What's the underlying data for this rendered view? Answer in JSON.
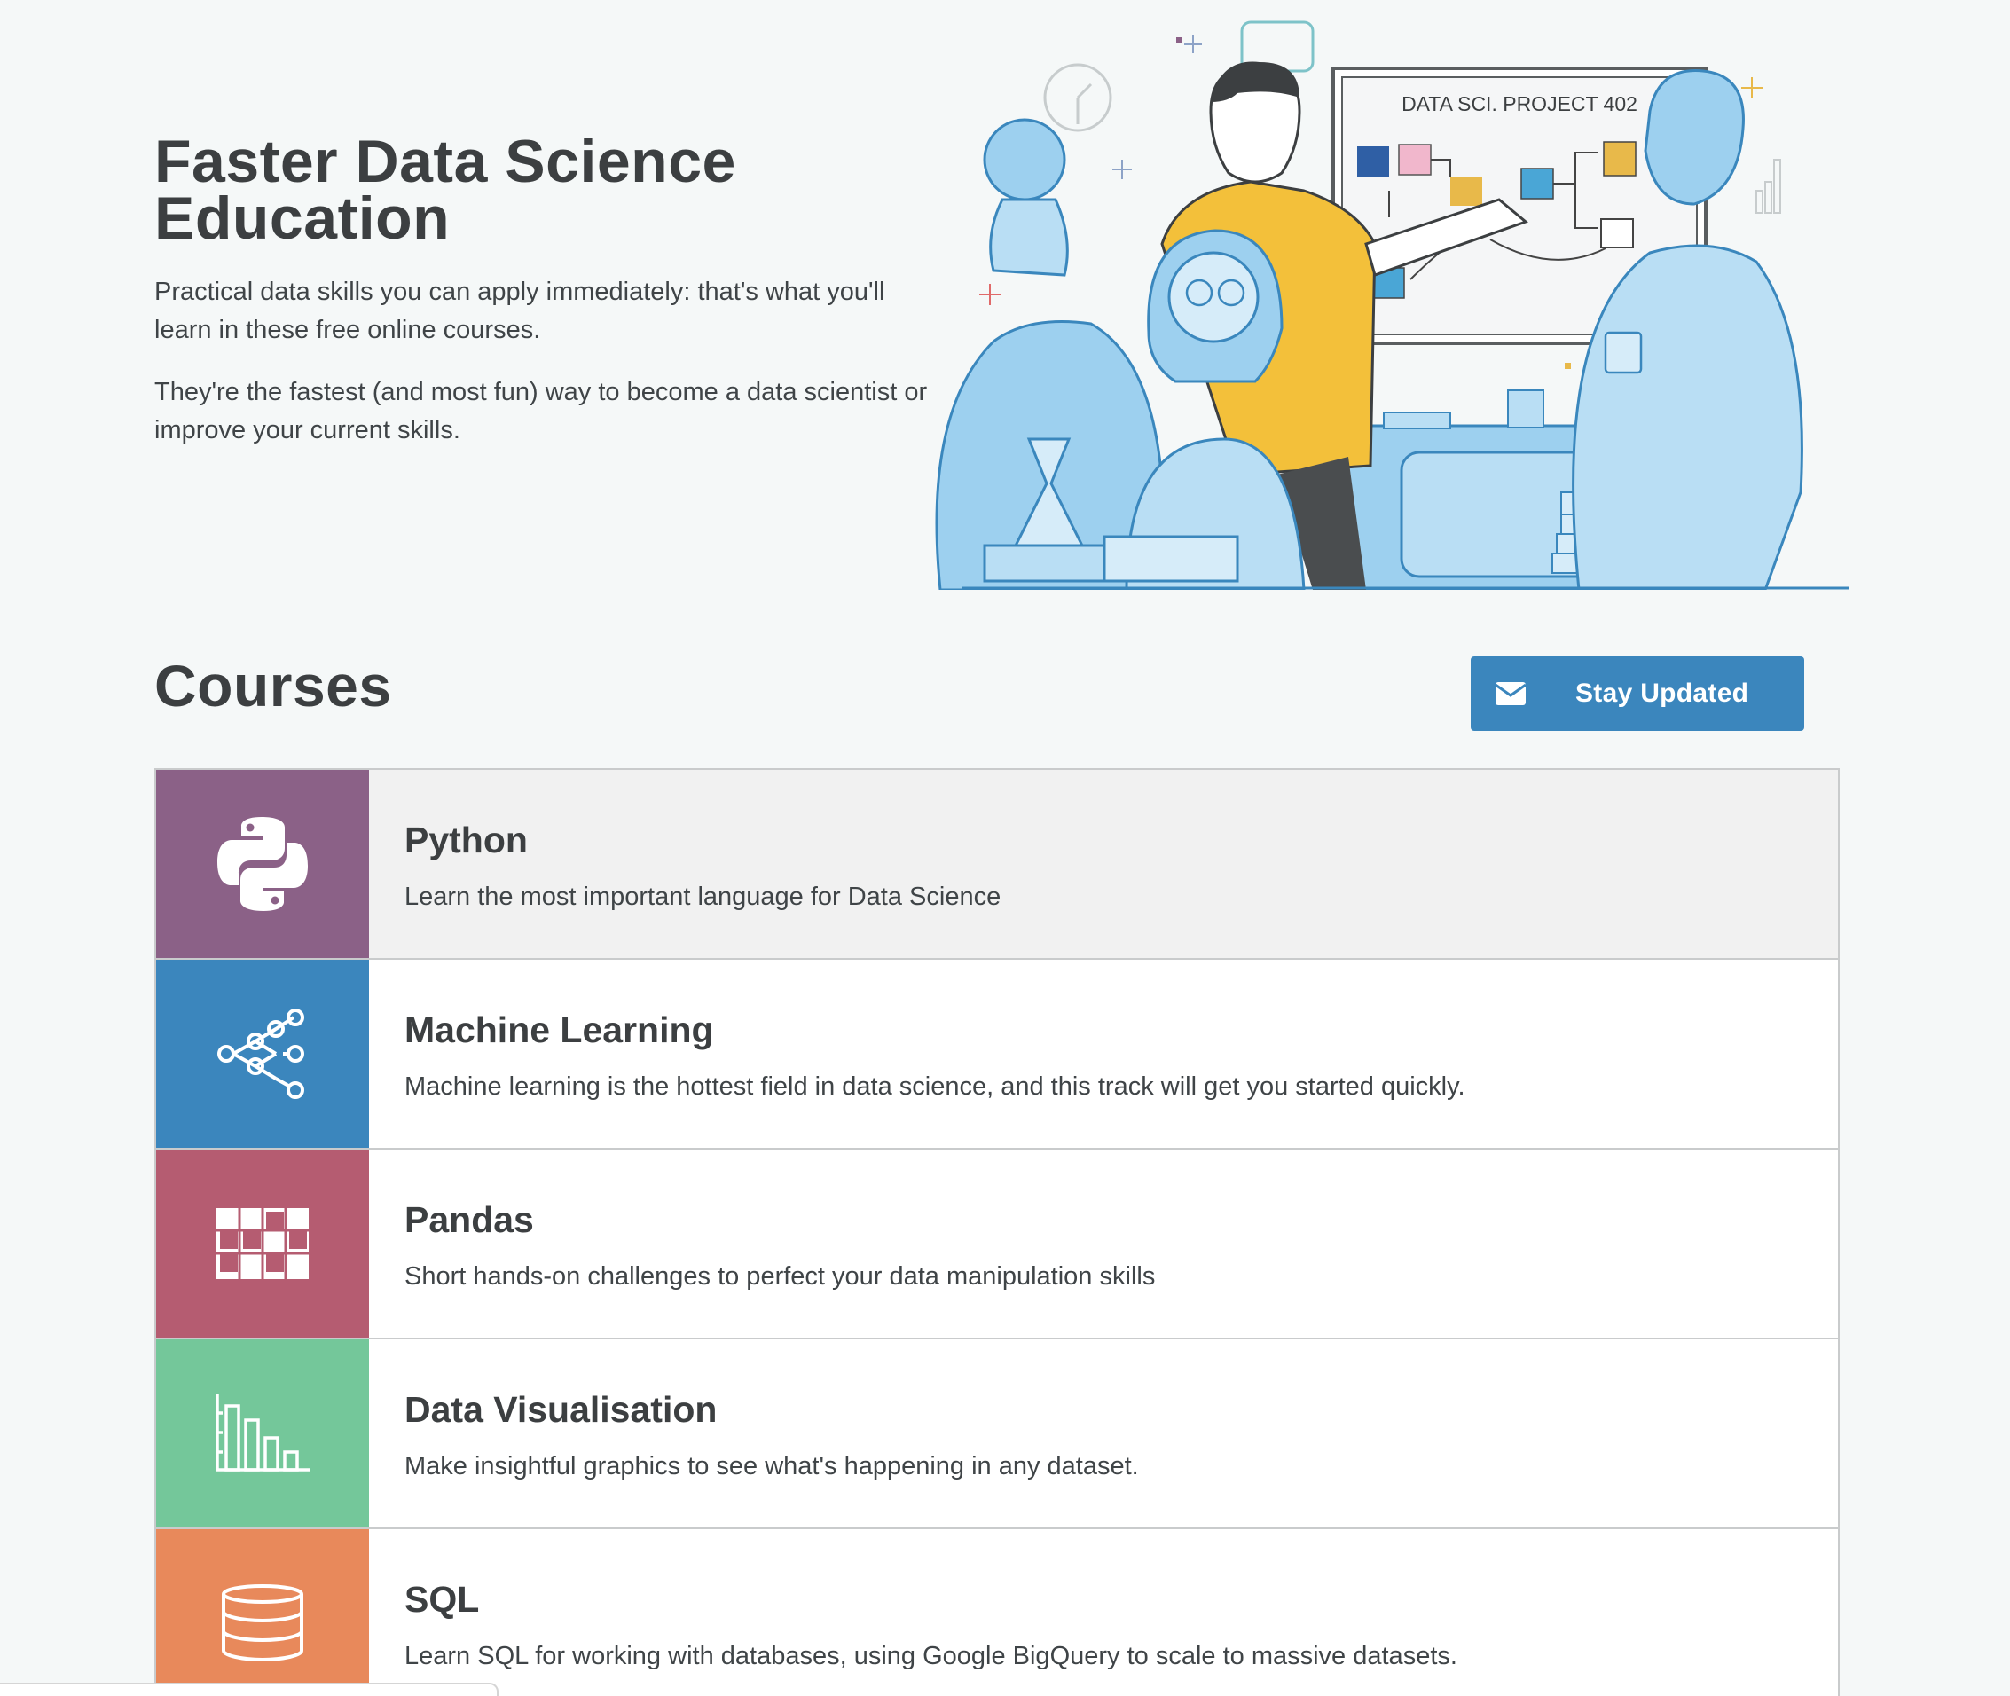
{
  "hero": {
    "title": "Faster Data Science Education",
    "paragraph1": "Practical data skills you can apply immediately: that's what you'll learn in these free online courses.",
    "paragraph2": "They're the fastest (and most fun) way to become a data scientist or improve your current skills.",
    "illustration": {
      "whiteboard_text": "DATA SCI. PROJECT 402"
    }
  },
  "courses_section": {
    "title": "Courses",
    "stay_updated_label": "Stay Updated",
    "stay_updated_icon": "envelope-icon",
    "button_color": "#3b86bd"
  },
  "courses": [
    {
      "title": "Python",
      "description": "Learn the most important language for Data Science",
      "icon": "python-icon",
      "color": "#8b6187"
    },
    {
      "title": "Machine Learning",
      "description": "Machine learning is the hottest field in data science, and this track will get you started quickly.",
      "icon": "network-graph-icon",
      "color": "#3b86bd"
    },
    {
      "title": "Pandas",
      "description": "Short hands-on challenges to perfect your data manipulation skills",
      "icon": "table-grid-icon",
      "color": "#b55c71"
    },
    {
      "title": "Data Visualisation",
      "description": "Make insightful graphics to see what's happening in any dataset.",
      "icon": "bar-chart-icon",
      "color": "#74c79a"
    },
    {
      "title": "SQL",
      "description": "Learn SQL for working with databases, using Google BigQuery to scale to massive datasets.",
      "icon": "database-icon",
      "color": "#e8895b"
    }
  ]
}
